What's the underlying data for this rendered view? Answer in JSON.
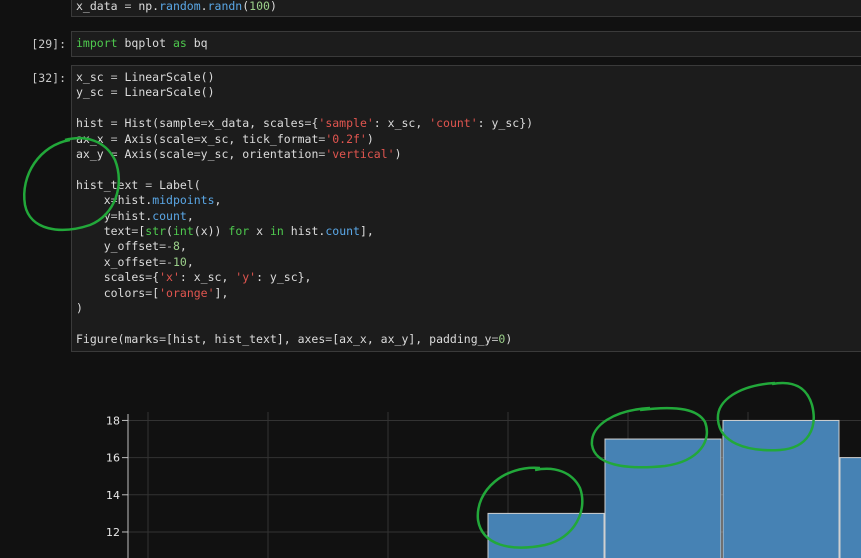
{
  "cells": [
    {
      "prompt": "",
      "lines": [
        [
          [
            "var",
            "x_data "
          ],
          [
            "op",
            "="
          ],
          [
            "var",
            " np."
          ],
          [
            "attr",
            "random"
          ],
          [
            "var",
            "."
          ],
          [
            "attr",
            "randn"
          ],
          [
            "var",
            "("
          ],
          [
            "num",
            "100"
          ],
          [
            "var",
            ")"
          ]
        ]
      ]
    },
    {
      "prompt": "[29]:",
      "lines": [
        [
          [
            "kw",
            "import"
          ],
          [
            "var",
            " bqplot "
          ],
          [
            "kw",
            "as"
          ],
          [
            "var",
            " bq"
          ]
        ]
      ]
    },
    {
      "prompt": "[32]:",
      "lines": [
        [
          [
            "var",
            "x_sc "
          ],
          [
            "op",
            "="
          ],
          [
            "var",
            " LinearScale()"
          ]
        ],
        [
          [
            "var",
            "y_sc "
          ],
          [
            "op",
            "="
          ],
          [
            "var",
            " LinearScale()"
          ]
        ],
        [],
        [
          [
            "var",
            "hist "
          ],
          [
            "op",
            "="
          ],
          [
            "var",
            " Hist(sample"
          ],
          [
            "op",
            "="
          ],
          [
            "var",
            "x_data, scales"
          ],
          [
            "op",
            "="
          ],
          [
            "var",
            "{"
          ],
          [
            "str",
            "'sample'"
          ],
          [
            "var",
            ": x_sc, "
          ],
          [
            "str",
            "'count'"
          ],
          [
            "var",
            ": y_sc})"
          ]
        ],
        [
          [
            "var",
            "ax_x "
          ],
          [
            "op",
            "="
          ],
          [
            "var",
            " Axis(scale"
          ],
          [
            "op",
            "="
          ],
          [
            "var",
            "x_sc, tick_format"
          ],
          [
            "op",
            "="
          ],
          [
            "str",
            "'0.2f'"
          ],
          [
            "var",
            ")"
          ]
        ],
        [
          [
            "var",
            "ax_y "
          ],
          [
            "op",
            "="
          ],
          [
            "var",
            " Axis(scale"
          ],
          [
            "op",
            "="
          ],
          [
            "var",
            "y_sc, orientation"
          ],
          [
            "op",
            "="
          ],
          [
            "str",
            "'vertical'"
          ],
          [
            "var",
            ")"
          ]
        ],
        [],
        [
          [
            "var",
            "hist_text "
          ],
          [
            "op",
            "="
          ],
          [
            "var",
            " Label("
          ]
        ],
        [
          [
            "var",
            "    x"
          ],
          [
            "op",
            "="
          ],
          [
            "var",
            "hist."
          ],
          [
            "attr",
            "midpoints"
          ],
          [
            "var",
            ","
          ]
        ],
        [
          [
            "var",
            "    y"
          ],
          [
            "op",
            "="
          ],
          [
            "var",
            "hist."
          ],
          [
            "attr",
            "count"
          ],
          [
            "var",
            ","
          ]
        ],
        [
          [
            "var",
            "    text"
          ],
          [
            "op",
            "="
          ],
          [
            "var",
            "["
          ],
          [
            "kw",
            "str"
          ],
          [
            "var",
            "("
          ],
          [
            "kw",
            "int"
          ],
          [
            "var",
            "(x)) "
          ],
          [
            "kw",
            "for"
          ],
          [
            "var",
            " x "
          ],
          [
            "kw",
            "in"
          ],
          [
            "var",
            " hist."
          ],
          [
            "attr",
            "count"
          ],
          [
            "var",
            "],"
          ]
        ],
        [
          [
            "var",
            "    y_offset"
          ],
          [
            "op",
            "="
          ],
          [
            "op",
            "-"
          ],
          [
            "num",
            "8"
          ],
          [
            "var",
            ","
          ]
        ],
        [
          [
            "var",
            "    x_offset"
          ],
          [
            "op",
            "="
          ],
          [
            "op",
            "-"
          ],
          [
            "num",
            "10"
          ],
          [
            "var",
            ","
          ]
        ],
        [
          [
            "var",
            "    scales"
          ],
          [
            "op",
            "="
          ],
          [
            "var",
            "{"
          ],
          [
            "str",
            "'x'"
          ],
          [
            "var",
            ": x_sc, "
          ],
          [
            "str",
            "'y'"
          ],
          [
            "var",
            ": y_sc},"
          ]
        ],
        [
          [
            "var",
            "    colors"
          ],
          [
            "op",
            "="
          ],
          [
            "var",
            "["
          ],
          [
            "str",
            "'orange'"
          ],
          [
            "var",
            "],"
          ]
        ],
        [
          [
            "var",
            ")"
          ]
        ],
        [],
        [
          [
            "var",
            "Figure(marks"
          ],
          [
            "op",
            "="
          ],
          [
            "var",
            "[hist, hist_text], axes"
          ],
          [
            "op",
            "="
          ],
          [
            "var",
            "[ax_x, ax_y], padding_y"
          ],
          [
            "op",
            "="
          ],
          [
            "num",
            "0"
          ],
          [
            "var",
            ")"
          ]
        ]
      ]
    }
  ],
  "chart_data": {
    "type": "bar",
    "ylim": [
      10.6,
      19.1
    ],
    "yticks": [
      12,
      14,
      16,
      18
    ],
    "ytick_labels": [
      "12",
      "14",
      "16",
      "18"
    ],
    "values": [
      13,
      17,
      18,
      16
    ],
    "grid": true
  },
  "colors": {
    "background": "#111111",
    "bar_fill": "#4682b4",
    "bar_stroke": "#d0d0d0",
    "grid": "#333333",
    "annotation": "#22a83a"
  }
}
